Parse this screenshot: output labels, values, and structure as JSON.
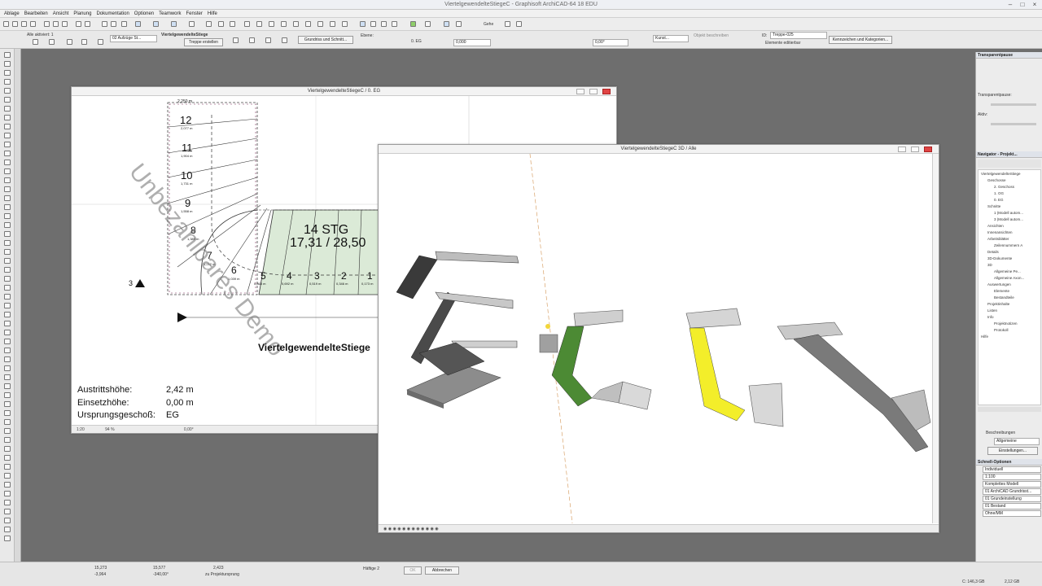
{
  "app": {
    "title": "ViertelgewendelteStiegeC - Graphisoft ArchiCAD-64 18 EDU"
  },
  "menu": [
    "Ablage",
    "Bearbeiten",
    "Ansicht",
    "Planung",
    "Dokumentation",
    "Optionen",
    "Teamwork",
    "Fenster",
    "Hilfe"
  ],
  "infobox": {
    "selection": "Alle aktiviert: 1",
    "layer": "02 Aufzüge St...",
    "geometry_label": "ViertelgewendelteStiege",
    "edit_button": "Treppe erstellen",
    "view_button": "Grundriss und Schnitt...",
    "floor": "0. EG",
    "elevation": "0,000",
    "angle": "0,00°",
    "material": "Kunst...",
    "id_label": "ID:",
    "id_value": "Treppe-025",
    "edit_elements": "Elemente editierbar",
    "objects_label": "Objekt beschreiben",
    "categories_button": "Kennzeichen und Kategorien...",
    "geho": "Gehe",
    "ebene": "Ebene:"
  },
  "plan": {
    "title": "ViertelgewendelteStiegeC / 0. EG",
    "steps": [
      "12",
      "11",
      "10",
      "9",
      "8",
      "7",
      "6",
      "5",
      "4",
      "3",
      "2",
      "1"
    ],
    "heights": [
      "2,077 m",
      "1,904 m",
      "1,731 m",
      "1,558 m",
      "1,385 m",
      "1,212 m",
      "1,039 m",
      "0,865 m",
      "0,692 m",
      "0,519 m",
      "0,346 m",
      "0,173 m"
    ],
    "top_dim": "2,250 m",
    "stg": "14 STG",
    "ratio": "17,31 / 28,50",
    "label_main": "ViertelgewendelteStiege",
    "marker": "3",
    "watermark": "Unbezahlbares Demo",
    "info": [
      {
        "k": "Austrittshöhe:",
        "v": "2,42 m"
      },
      {
        "k": "Einsetzhöhe:",
        "v": "0,00 m"
      },
      {
        "k": "Ursprungsgeschoß:",
        "v": "EG"
      }
    ],
    "footer": {
      "scale": "1:20",
      "zoom": "94 %",
      "angle": "0,00°"
    }
  },
  "view3d": {
    "title": "ViertelgewendelteStiegeC 3D / Alle"
  },
  "navigator": {
    "transparent_header": "Transparentpause",
    "transparent_label": "Transparentpause:",
    "active_label": "Aktiv:",
    "nav_header": "Navigator - Projekt...",
    "tree": [
      {
        "d": 0,
        "t": "ViertelgewendelteStiege"
      },
      {
        "d": 1,
        "t": "Geschosse"
      },
      {
        "d": 2,
        "t": "2. Geschoss"
      },
      {
        "d": 2,
        "t": "1. OG"
      },
      {
        "d": 2,
        "t": "0. EG"
      },
      {
        "d": 1,
        "t": "Schnitte"
      },
      {
        "d": 2,
        "t": "1 (Modell autom..."
      },
      {
        "d": 2,
        "t": "3 (Modell autom..."
      },
      {
        "d": 1,
        "t": "Ansichten"
      },
      {
        "d": 1,
        "t": "Innenansichten"
      },
      {
        "d": 1,
        "t": "Arbeitsblätter"
      },
      {
        "d": 2,
        "t": "Zeilennummern A"
      },
      {
        "d": 1,
        "t": "Details"
      },
      {
        "d": 1,
        "t": "3D-Dokumente"
      },
      {
        "d": 1,
        "t": "3D"
      },
      {
        "d": 2,
        "t": "Allgemeine Pe..."
      },
      {
        "d": 2,
        "t": "Allgemeine Axon..."
      },
      {
        "d": 1,
        "t": "Auswertungen"
      },
      {
        "d": 2,
        "t": "Elemente"
      },
      {
        "d": 2,
        "t": "Bestandteile"
      },
      {
        "d": 1,
        "t": "Projektinhalte"
      },
      {
        "d": 1,
        "t": "Listen"
      },
      {
        "d": 1,
        "t": "Info"
      },
      {
        "d": 2,
        "t": "Projektnotizen"
      },
      {
        "d": 2,
        "t": "Protokoll"
      },
      {
        "d": 0,
        "t": "Hilfe"
      }
    ],
    "desc_header": "Beschreibungen",
    "desc_field": "Allgemeine",
    "settings_button": "Einstellungen...",
    "schnell_header": "Schnell-Optionen",
    "schnell": [
      "Individuell",
      "1:100",
      "Komplettes Modell",
      "01 ArchiCAD Grundrisst...",
      "01 Grundeinstellung",
      "01 Bestand",
      "Ohne/MM"
    ]
  },
  "status": {
    "x": "15,273",
    "y": "-3,964",
    "dx": "15,577",
    "dy": "-340,00°",
    "dz": "2,423",
    "ref": "zu Projektursprung",
    "floors": "Häftige 2",
    "ok": "OK",
    "cancel": "Abbrechen",
    "disk": "C: 146,3 GB",
    "mem": "2,12 GB"
  }
}
